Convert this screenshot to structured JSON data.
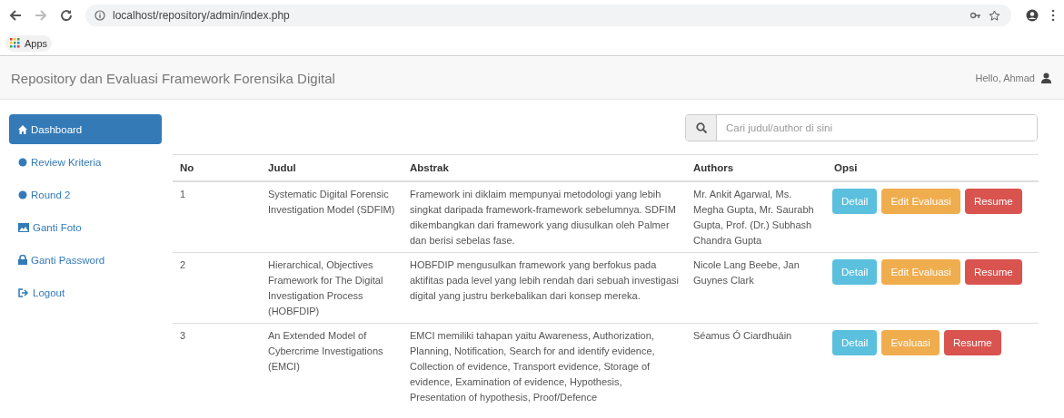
{
  "browser": {
    "url": "localhost/repository/admin/index.php",
    "bookmarks": [
      "Apps"
    ]
  },
  "navbar": {
    "brand": "Repository dan Evaluasi Framework Forensika Digital",
    "greeting": "Hello, Ahmad"
  },
  "sidebar": {
    "items": [
      {
        "label": "Dashboard",
        "selected": true
      },
      {
        "label": "Review Kriteria",
        "selected": false
      },
      {
        "label": "Round 2",
        "selected": false
      },
      {
        "label": "Ganti Foto",
        "selected": false
      },
      {
        "label": "Ganti Password",
        "selected": false
      },
      {
        "label": "Logout",
        "selected": false
      }
    ]
  },
  "search": {
    "placeholder": "Cari judul/author di sini"
  },
  "table": {
    "columns": [
      "No",
      "Judul",
      "Abstrak",
      "Authors",
      "Opsi"
    ],
    "rows": [
      {
        "no": "1",
        "judul": "Systematic Digital Forensic Investigation Model (SDFIM)",
        "abstrak": "Framework ini diklaim mempunyai metodologi yang lebih singkat daripada framework-framework sebelumnya. SDFIM dikembangkan dari framework yang diusulkan oleh Palmer dan berisi sebelas fase.",
        "authors": "Mr. Ankit Agarwal, Ms. Megha Gupta, Mr. Saurabh Gupta, Prof. (Dr.) Subhash Chandra Gupta",
        "actions": [
          {
            "label": "Detail",
            "kind": "info"
          },
          {
            "label": "Edit Evaluasi",
            "kind": "warning"
          },
          {
            "label": "Resume",
            "kind": "danger"
          }
        ]
      },
      {
        "no": "2",
        "judul": "Hierarchical, Objectives Framework for The Digital Investigation Process (HOBFDIP)",
        "abstrak": "HOBFDIP mengusulkan framework yang berfokus pada aktifitas pada level yang lebih rendah dari sebuah investigasi digital yang justru berkebalikan dari konsep mereka.",
        "authors": "Nicole Lang Beebe, Jan Guynes Clark",
        "actions": [
          {
            "label": "Detail",
            "kind": "info"
          },
          {
            "label": "Edit Evaluasi",
            "kind": "warning"
          },
          {
            "label": "Resume",
            "kind": "danger"
          }
        ]
      },
      {
        "no": "3",
        "judul": "An Extended Model of Cybercrime Investigations (EMCI)",
        "abstrak": "EMCI memiliki tahapan yaitu Awareness, Authorization, Planning, Notification, Search for and identify evidence, Collection of evidence, Transport evidence, Storage of evidence, Examination of evidence, Hypothesis, Presentation of hypothesis, Proof/Defence",
        "authors": "Séamus Ó Ciardhuáin",
        "actions": [
          {
            "label": "Detail",
            "kind": "info"
          },
          {
            "label": "Evaluasi",
            "kind": "warning"
          },
          {
            "label": "Resume",
            "kind": "danger"
          }
        ]
      }
    ]
  }
}
